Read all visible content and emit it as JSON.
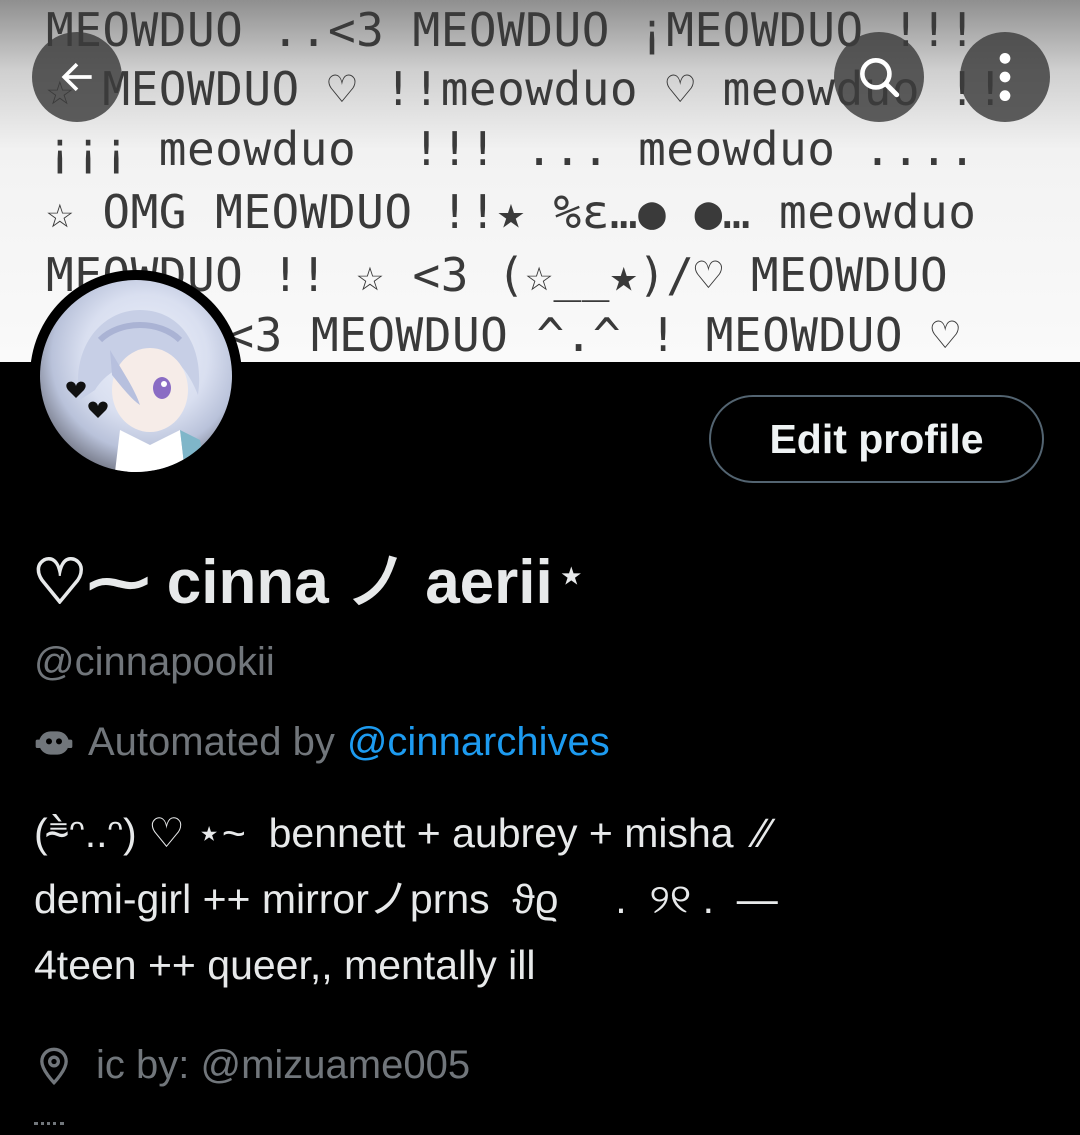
{
  "banner": {
    "lines": [
      "MEOWDUO ..<3 MEOWDUO ¡MEOWDUO !!!",
      "☆ MEOWDUO ♡ !!meowduo ♡ meowduo !!",
      "¡¡¡ meowduo  !!! ... meowduo ....",
      "☆ OMG MEOWDUO !!★ %ɛ…● ●… meowduo",
      "MEOWDUO !! ☆ <3 (☆__★)/♡ MEOWDUO",
      "♡ <3 MEOWDUO ^.^ ! MEOWDUO ♡"
    ]
  },
  "toolbar": {
    "back_icon": "arrow-left-icon",
    "search_icon": "search-icon",
    "more_icon": "more-vertical-icon"
  },
  "profile": {
    "avatar_alt": "avatar",
    "edit_button": "Edit profile",
    "display_name": "♡⁓ cinna ノ aerii",
    "name_badge": "⋆",
    "handle": "@cinnapookii",
    "automated_label": "Automated by",
    "automated_link": "@cinnarchives",
    "bio_lines": [
      "(⁼̴̀ᵔ..ᵔ) ♡ ⋆~  bennett + aubrey + misha  ⁄⁄",
      "demi-girl ++ mirrorノprns  ϑϱ     .  ୨୧ .  —",
      "4teen ++ queer,, mentally ill"
    ],
    "location": "ic by: @mizuame005"
  },
  "colors": {
    "background": "#000000",
    "text_primary": "#e7e9ea",
    "text_secondary": "#71767b",
    "link": "#1d9bf0",
    "button_border": "#536471"
  }
}
